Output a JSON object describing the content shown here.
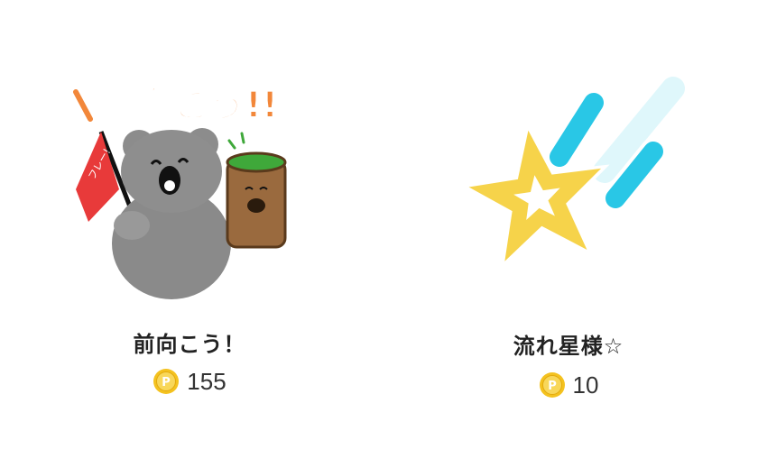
{
  "items": [
    {
      "title": "前向こう！",
      "sticker_text": "前向こう!!",
      "flag_text": "フレー!",
      "price": "155",
      "icon": "koala-sticker-icon"
    },
    {
      "title": "流れ星様☆",
      "price": "10",
      "icon": "shooting-star-sticker-icon"
    }
  ],
  "currency_icon": "coin-icon",
  "colors": {
    "coin": "#f4c21f",
    "title": "#222222",
    "price": "#333333",
    "star": "#f6d34a",
    "streak": "#29c7e6",
    "sticker_text": "#f2873a"
  }
}
